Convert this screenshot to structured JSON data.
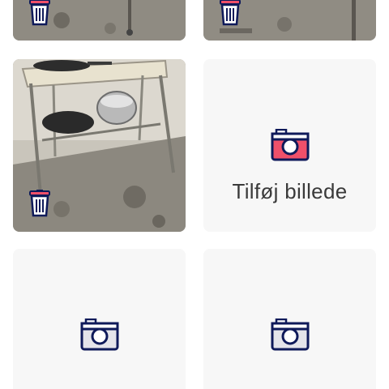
{
  "colors": {
    "accent": "#0f1a5a",
    "camera_active_fill": "#f0506a",
    "camera_inactive_fill": "#e4e4ea",
    "tile_bg": "#f7f7f7",
    "trash_fill": "#ffffff"
  },
  "icons": {
    "delete": "trash-icon",
    "add_photo": "camera-icon"
  },
  "photos": [
    {
      "name": "uploaded-photo-1",
      "has_delete": true
    },
    {
      "name": "uploaded-photo-2",
      "has_delete": true
    },
    {
      "name": "uploaded-photo-3",
      "has_delete": true
    }
  ],
  "add_tile": {
    "label": "Tilføj billede"
  }
}
